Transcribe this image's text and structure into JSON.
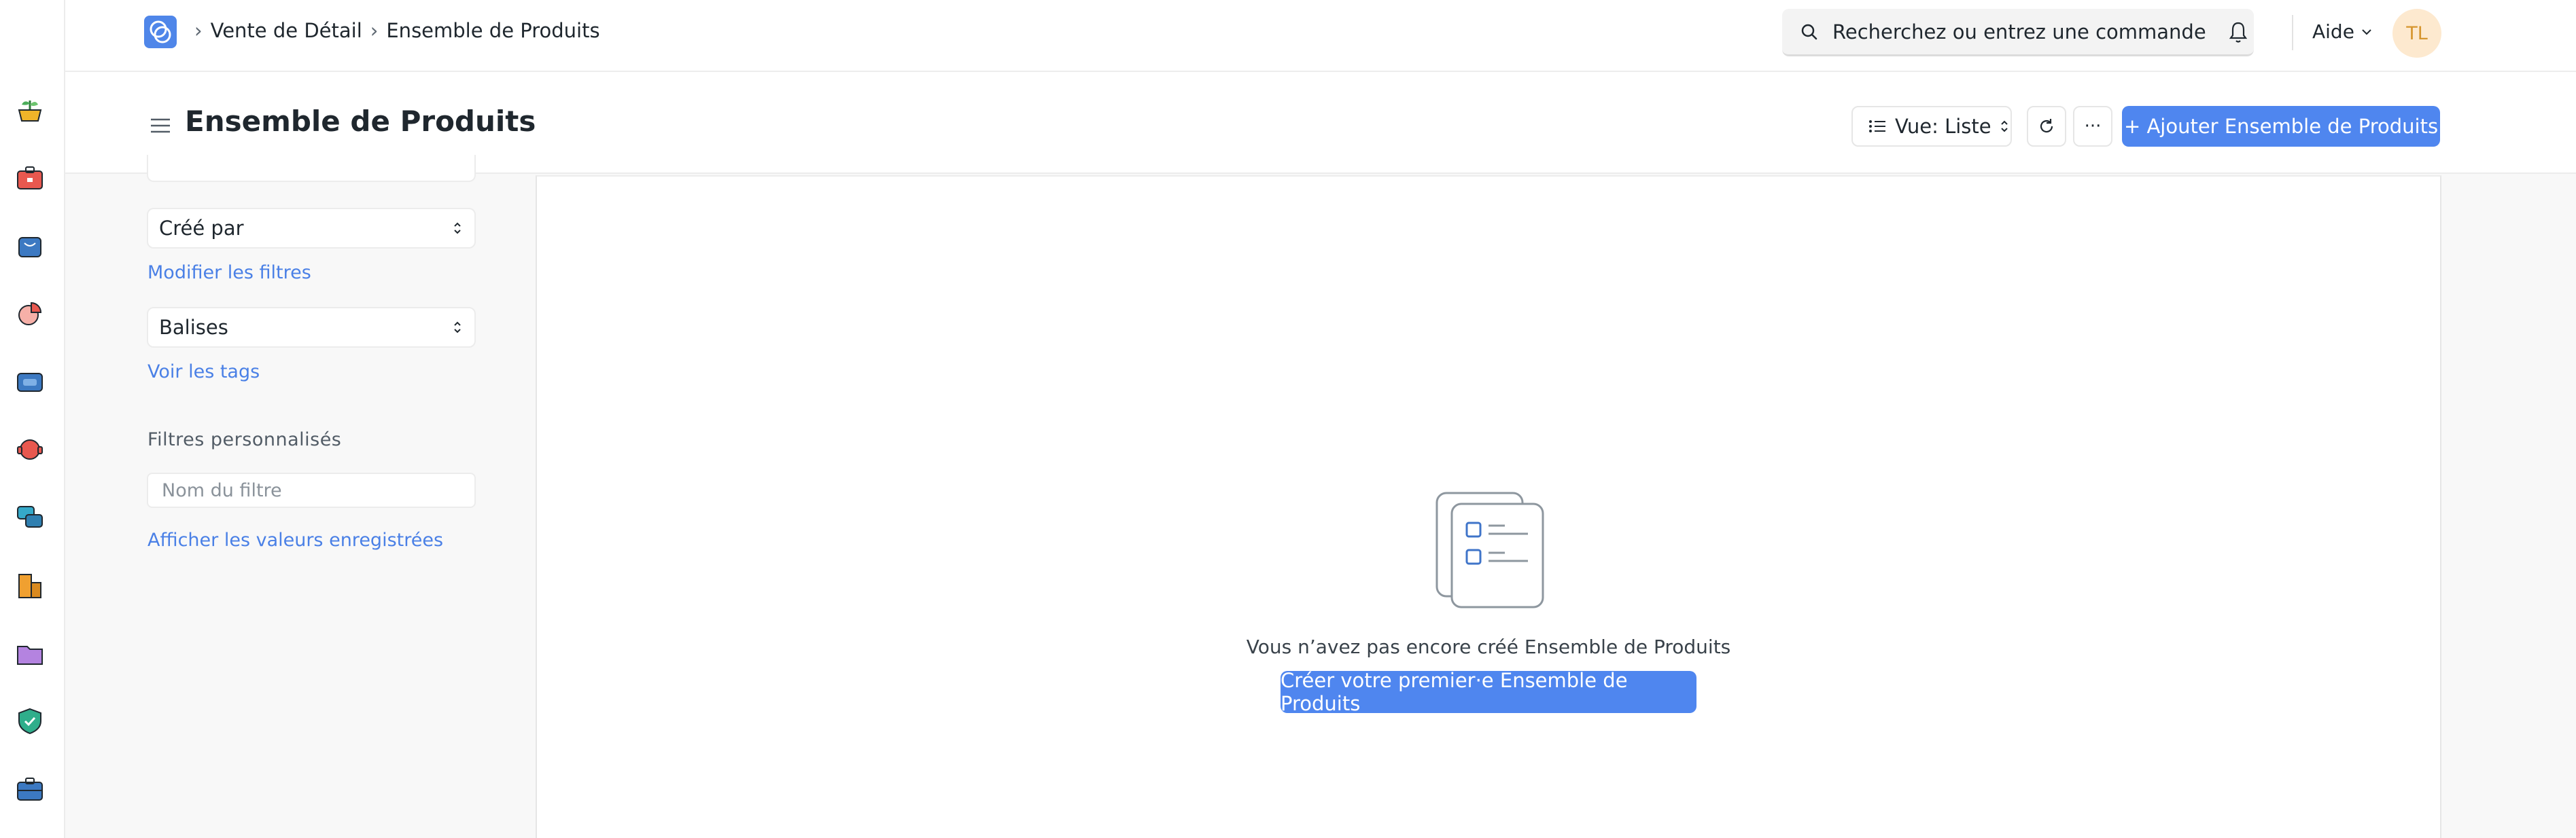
{
  "breadcrumb": {
    "items": [
      "Vente de Détail",
      "Ensemble de Produits"
    ]
  },
  "search": {
    "placeholder": "Recherchez ou entrez une commande"
  },
  "help": {
    "label": "Aide"
  },
  "user": {
    "initials": "TL"
  },
  "page": {
    "title": "Ensemble de Produits"
  },
  "toolbar": {
    "view_label": "Vue: Liste",
    "more_label": "···",
    "add_label": "+ Ajouter Ensemble de Produits"
  },
  "sidebar": {
    "select_created_by": "Créé par",
    "edit_filters_link": "Modifier les filtres",
    "select_tags": "Balises",
    "show_tags_link": "Voir les tags",
    "custom_filters_label": "Filtres personnalisés",
    "filter_name_placeholder": "Nom du filtre",
    "saved_values_link": "Afficher les valeurs enregistrées"
  },
  "empty_state": {
    "message": "Vous n’avez pas encore créé Ensemble de Produits",
    "create_button": "Créer votre premier·e Ensemble de Produits"
  },
  "colors": {
    "primary": "#4f86ef",
    "link": "#4a80e6",
    "avatar_bg": "#fde9cf",
    "avatar_text": "#d6952e"
  },
  "rail_icons": [
    "plant-pot-icon",
    "toolbox-icon",
    "shopping-bag-icon",
    "pie-chart-icon",
    "wallet-icon",
    "support-icon",
    "chat-icon",
    "buildings-icon",
    "folder-icon",
    "shield-check-icon",
    "briefcase-icon"
  ]
}
